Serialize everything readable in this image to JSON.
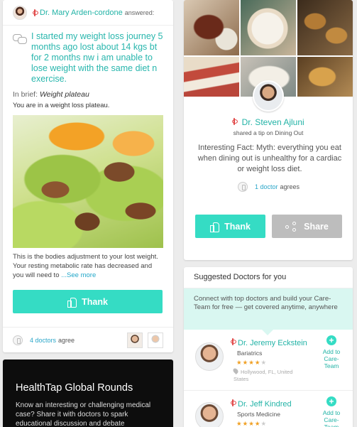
{
  "qa_card": {
    "doctor_name": "Dr. Mary Arden-cordone",
    "answered_label": "answered:",
    "question": "I started my weight loss journey 5 months ago lost about 14 kgs bt for 2 months nw i am unable to lose weight with the same diet n exercise.",
    "brief_label": "In brief:",
    "brief_value": "Weight plateau",
    "brief_summary": "You are in a weight loss plateau.",
    "answer_text": "This is the bodies adjustment to your lost weight. Your resting metabolic rate has decreased and you will need to",
    "see_more": "...See more",
    "thank_label": "Thank",
    "agree_count": "4 doctors",
    "agree_label": "agree"
  },
  "rounds_card": {
    "title": "HealthTap Global Rounds",
    "description": "Know an interesting or challenging medical case? Share it with doctors to spark educational discussion and debate"
  },
  "tip_card": {
    "doctor_name": "Dr. Steven Ajluni",
    "shared_label": "shared a tip on Dining Out",
    "tip_text": "Interesting Fact: Myth: everything you eat when dining out is unhealthy for a cardiac or weight loss diet.",
    "agree_count": "1 doctor",
    "agree_label": "agrees",
    "thank_label": "Thank",
    "share_label": "Share"
  },
  "suggested": {
    "title": "Suggested Doctors for you",
    "banner": "Connect with top doctors and build your Care-Team for free — get covered anytime, anywhere",
    "doctors": [
      {
        "name": "Dr. Jeremy Eckstein",
        "specialty": "Bariatrics",
        "stars_filled": "★★★★",
        "stars_empty": "★",
        "location": "Hollywood, FL, United States",
        "add_label": "Add to Care-Team"
      },
      {
        "name": "Dr. Jeff Kindred",
        "specialty": "Sports Medicine",
        "stars_filled": "★★★★",
        "stars_empty": "★",
        "add_label": "Add to Care-Team"
      }
    ]
  },
  "colors": {
    "accent": "#35dcc4",
    "link": "#22b3a6",
    "share_button": "#bdbdbd"
  },
  "icons": [
    "doctor-avatar",
    "caduceus-icon",
    "chat-bubbles-icon",
    "thumbs-up-icon",
    "share-icon",
    "agree-badge-icon",
    "location-pin-icon",
    "add-circle-icon",
    "star-icon"
  ]
}
